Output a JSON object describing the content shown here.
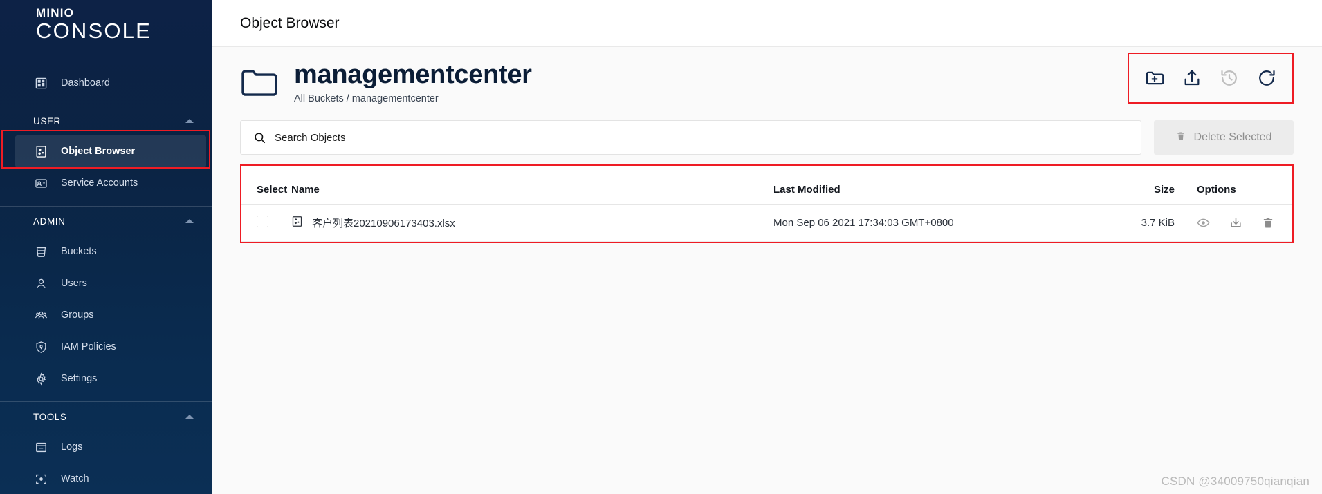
{
  "sidebar": {
    "logo_top": "MINIO",
    "logo_bottom": "CONSOLE",
    "dashboard": {
      "label": "Dashboard",
      "icon": "dashboard-icon"
    },
    "sections": [
      {
        "title": "USER",
        "items": [
          {
            "label": "Object Browser",
            "icon": "object-browser-icon",
            "active": true
          },
          {
            "label": "Service Accounts",
            "icon": "service-accounts-icon",
            "active": false
          }
        ]
      },
      {
        "title": "ADMIN",
        "items": [
          {
            "label": "Buckets",
            "icon": "bucket-icon",
            "active": false
          },
          {
            "label": "Users",
            "icon": "user-icon",
            "active": false
          },
          {
            "label": "Groups",
            "icon": "groups-icon",
            "active": false
          },
          {
            "label": "IAM Policies",
            "icon": "shield-icon",
            "active": false
          },
          {
            "label": "Settings",
            "icon": "gear-icon",
            "active": false
          }
        ]
      },
      {
        "title": "TOOLS",
        "items": [
          {
            "label": "Logs",
            "icon": "logs-icon",
            "active": false
          },
          {
            "label": "Watch",
            "icon": "watch-icon",
            "active": false
          }
        ]
      }
    ]
  },
  "topbar": {
    "title": "Object Browser"
  },
  "bucket": {
    "name": "managementcenter",
    "breadcrumb": "All Buckets / managementcenter",
    "folder_icon": "folder-icon"
  },
  "header_actions": [
    {
      "name": "create-folder-button",
      "icon": "folder-plus-icon",
      "disabled": false
    },
    {
      "name": "upload-button",
      "icon": "upload-icon",
      "disabled": false
    },
    {
      "name": "version-history-button",
      "icon": "history-icon",
      "disabled": true
    },
    {
      "name": "refresh-button",
      "icon": "refresh-icon",
      "disabled": false
    }
  ],
  "search": {
    "placeholder": "Search Objects",
    "value": "",
    "icon": "search-icon"
  },
  "delete_selected": {
    "label": "Delete Selected",
    "icon": "trash-icon",
    "disabled": true
  },
  "table": {
    "columns": [
      "Select",
      "Name",
      "Last Modified",
      "Size",
      "Options"
    ],
    "rows": [
      {
        "selected": false,
        "name": "客户列表20210906173403.xlsx",
        "file_icon": "spreadsheet-file-icon",
        "last_modified": "Mon Sep 06 2021 17:34:03 GMT+0800",
        "size": "3.7 KiB",
        "options": [
          "preview-icon",
          "download-icon",
          "delete-icon"
        ]
      }
    ]
  },
  "watermark": "CSDN @34009750qianqian",
  "colors": {
    "sidebar_top": "#0d2246",
    "sidebar_bottom": "#0b2f55",
    "annotation_red": "#ee1c24",
    "icon_navy": "#13294b",
    "disabled_gray": "#b9b9b9"
  }
}
